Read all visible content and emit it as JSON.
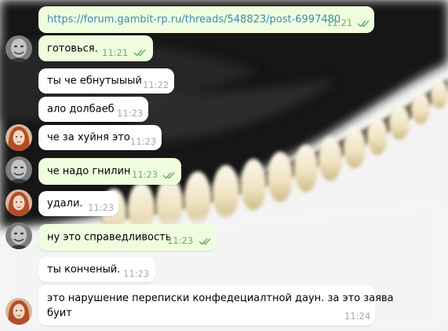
{
  "chat": {
    "messages": [
      {
        "text": "https://forum.gambit-rp.ru/threads/548823/post-6997480",
        "time": "11:21",
        "direction": "out",
        "read": true
      },
      {
        "text": "готовься.",
        "time": "11:21",
        "direction": "out",
        "read": true
      },
      {
        "text": "ты че ебнутыыый",
        "time": "11:22",
        "direction": "in"
      },
      {
        "text": "ало долбаеб",
        "time": "11:23",
        "direction": "in"
      },
      {
        "text": "че за хуйня это",
        "time": "11:23",
        "direction": "in"
      },
      {
        "text": "че надо гнилин",
        "time": "11:23",
        "direction": "out",
        "read": true
      },
      {
        "text": "удали.",
        "time": "11:23",
        "direction": "in"
      },
      {
        "text": "ну это справедливость",
        "time": "11:23",
        "direction": "out",
        "read": true
      },
      {
        "text": "ты конченый.",
        "time": "11:23",
        "direction": "in"
      },
      {
        "text_line1": "это нарушение переписки конфедециалтной даун. за это заява",
        "text_line2": "буит",
        "time": "11:24",
        "direction": "in"
      }
    ]
  },
  "colors": {
    "outgoing_bubble": "#effdde",
    "incoming_bubble": "#ffffff",
    "link": "#3a8bb8",
    "outgoing_time": "#6cb05f",
    "incoming_time": "#a0acb6"
  },
  "icons": {
    "read_receipt": "double-check-icon",
    "avatar_self": "avatar-man",
    "avatar_peer": "avatar-woman"
  }
}
